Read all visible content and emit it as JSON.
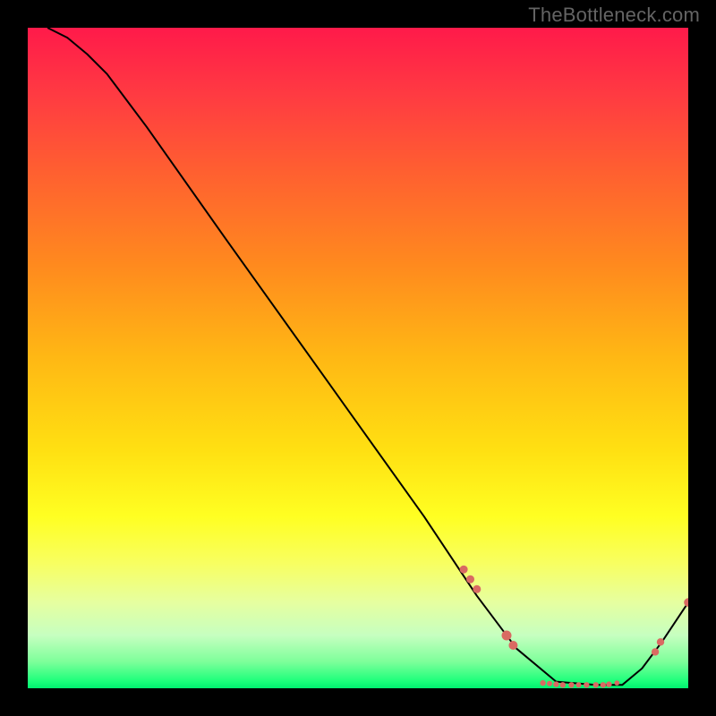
{
  "watermark": "TheBottleneck.com",
  "chart_data": {
    "type": "line",
    "title": "",
    "xlabel": "",
    "ylabel": "",
    "xlim": [
      0,
      100
    ],
    "ylim": [
      0,
      100
    ],
    "grid": false,
    "series": [
      {
        "name": "curve",
        "color": "#000000",
        "x": [
          3,
          6,
          9,
          12,
          18,
          30,
          45,
          60,
          68,
          74,
          80,
          86,
          90,
          93,
          96,
          100
        ],
        "y": [
          100,
          98.5,
          96,
          93,
          85,
          68,
          47,
          26,
          14,
          6,
          1,
          0.5,
          0.5,
          3,
          7,
          13
        ]
      }
    ],
    "markers": [
      {
        "x": 66,
        "y": 18,
        "r": 4.5
      },
      {
        "x": 67,
        "y": 16.5,
        "r": 4.5
      },
      {
        "x": 68,
        "y": 15,
        "r": 4.5
      },
      {
        "x": 72.5,
        "y": 8,
        "r": 5.5
      },
      {
        "x": 73.5,
        "y": 6.5,
        "r": 5
      },
      {
        "x": 78,
        "y": 0.8,
        "r": 3.2
      },
      {
        "x": 79,
        "y": 0.7,
        "r": 3.0
      },
      {
        "x": 80,
        "y": 0.6,
        "r": 3.2
      },
      {
        "x": 81,
        "y": 0.5,
        "r": 3.2
      },
      {
        "x": 82.3,
        "y": 0.5,
        "r": 3.2
      },
      {
        "x": 83.4,
        "y": 0.5,
        "r": 3.0
      },
      {
        "x": 84.6,
        "y": 0.5,
        "r": 3.2
      },
      {
        "x": 86,
        "y": 0.5,
        "r": 3.2
      },
      {
        "x": 87.1,
        "y": 0.5,
        "r": 3.2
      },
      {
        "x": 88.0,
        "y": 0.6,
        "r": 3.2
      },
      {
        "x": 89.2,
        "y": 0.8,
        "r": 2.8
      },
      {
        "x": 95,
        "y": 5.5,
        "r": 4.2
      },
      {
        "x": 95.8,
        "y": 7,
        "r": 4.2
      },
      {
        "x": 100,
        "y": 13,
        "r": 4.8
      }
    ],
    "marker_color": "#d96a62"
  }
}
